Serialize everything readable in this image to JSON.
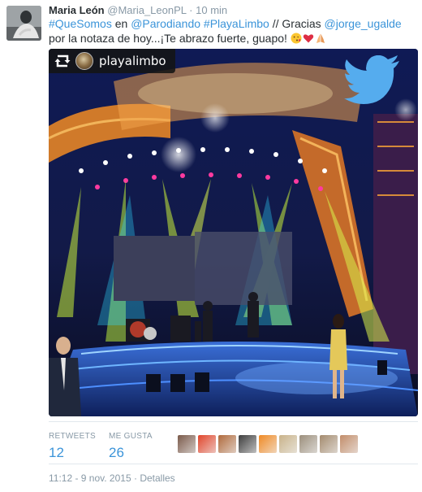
{
  "tweet": {
    "author_name": "Maria León",
    "author_handle": "@Maria_LeonPL",
    "separator": "·",
    "time_ago": "10 min",
    "text_segments": [
      {
        "text": "#QueSomos",
        "link": true
      },
      {
        "text": " en ",
        "link": false
      },
      {
        "text": "@Parodiando",
        "link": true
      },
      {
        "text": " ",
        "link": false
      },
      {
        "text": "#PlayaLimbo",
        "link": true
      },
      {
        "text": " // Gracias ",
        "link": false
      },
      {
        "text": "@jorge_ugalde",
        "link": true
      },
      {
        "text": " por la notaza de hoy...¡Te abrazo fuerte, guapo! ",
        "link": false
      }
    ],
    "emojis": [
      "kiss-face-emoji",
      "red-heart-emoji",
      "folded-hands-emoji"
    ]
  },
  "media": {
    "repost_username": "playalimbo",
    "icons": {
      "repost": "repost-icon",
      "brand": "twitter-bird-icon"
    }
  },
  "stats": {
    "retweets_label": "RETWEETS",
    "retweets_count": "12",
    "likes_label": "ME GUSTA",
    "likes_count": "26"
  },
  "likers": [
    {
      "color": "#7b5a4a"
    },
    {
      "color": "#e1452b"
    },
    {
      "color": "#b06a3c"
    },
    {
      "color": "#3d3d3d"
    },
    {
      "color": "#f08a24"
    },
    {
      "color": "#c9b38a"
    },
    {
      "color": "#9c8f7c"
    },
    {
      "color": "#a48b6e"
    },
    {
      "color": "#c28d6a"
    }
  ],
  "footer": {
    "timestamp": "11:12 - 9 nov. 2015",
    "separator": "·",
    "details_link": "Detalles"
  },
  "colors": {
    "link": "#3b94d9",
    "meta": "#8899a6",
    "text": "#292f33",
    "twitter_blue": "#55acee"
  }
}
